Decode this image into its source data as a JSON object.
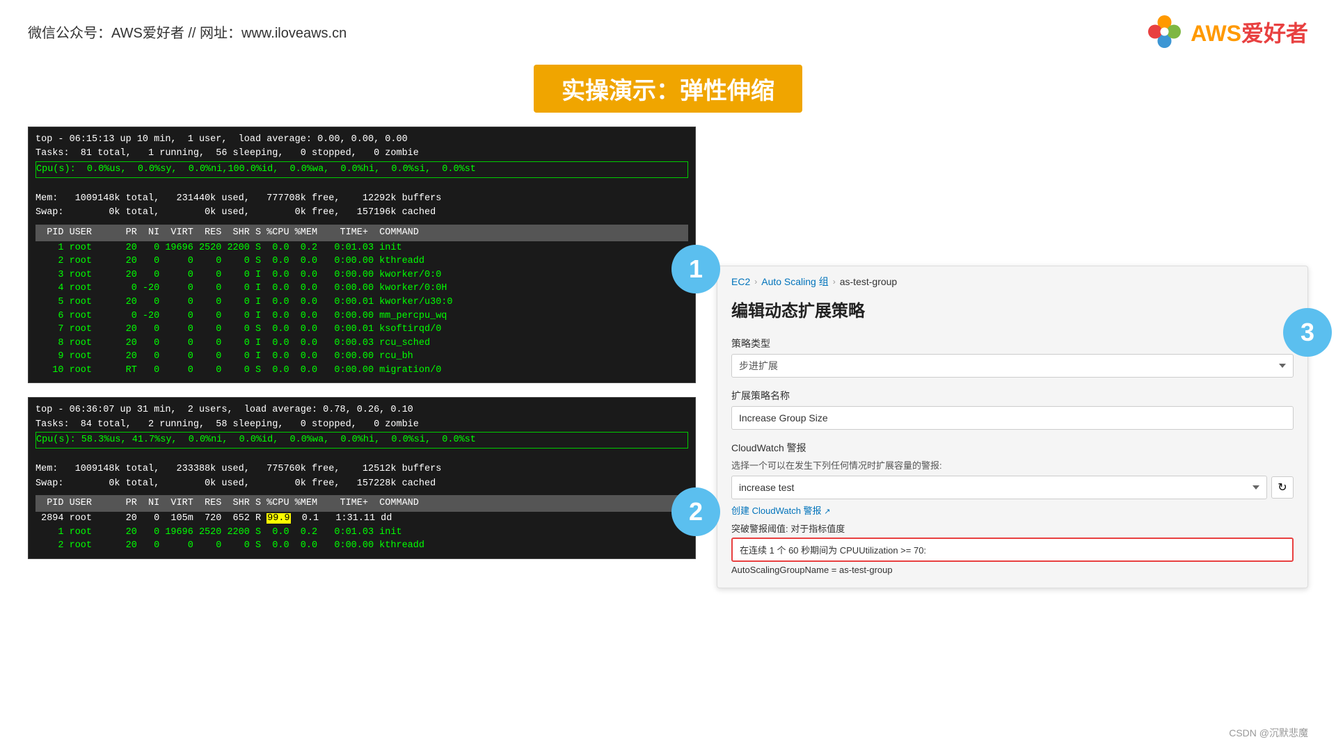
{
  "header": {
    "wechat_text": "微信公众号：AWS爱好者  //  网址：www.iloveaws.cn",
    "logo_text": "AWS爱好者"
  },
  "title": "实操演示：弹性伸缩",
  "terminal1": {
    "line1": "top - 06:15:13 up 10 min,  1 user,  load average: 0.00, 0.00, 0.00",
    "line2": "Tasks:  81 total,   1 running,  56 sleeping,   0 stopped,   0 zombie",
    "line3_highlight": "Cpu(s):  0.0%us,  0.0%sy,  0.0%ni,100.0%id,  0.0%wa,  0.0%hi,  0.0%si,  0.0%st",
    "line4": "Mem:   1009148k total,   231440k used,   777708k free,    12292k buffers",
    "line5": "Swap:        0k total,        0k used,        0k free,   157196k cached",
    "table_header": "  PID USER      PR  NI  VIRT  RES  SHR S %CPU %MEM    TIME+  COMMAND",
    "rows": [
      "    1 root      20   0 19696 2520 2200 S  0.0  0.2   0:01.03 init",
      "    2 root      20   0     0    0    0 S  0.0  0.0   0:00.00 kthreadd",
      "    3 root      20   0     0    0    0 I  0.0  0.0   0:00.00 kworker/0:0",
      "    4 root       0 -20     0    0    0 I  0.0  0.0   0:00.00 kworker/0:0H",
      "    5 root      20   0     0    0    0 I  0.0  0.0   0:00.01 kworker/u30:0",
      "    6 root       0 -20     0    0    0 I  0.0  0.0   0:00.00 mm_percpu_wq",
      "    7 root      20   0     0    0    0 S  0.0  0.0   0:00.01 ksoftirqd/0",
      "    8 root      20   0     0    0    0 I  0.0  0.0   0:00.03 rcu_sched",
      "    9 root      20   0     0    0    0 I  0.0  0.0   0:00.00 rcu_bh",
      "   10 root      RT   0     0    0    0 S  0.0  0.0   0:00.00 migration/0"
    ],
    "badge": "1"
  },
  "terminal2": {
    "line1": "top - 06:36:07 up 31 min,  2 users,  load average: 0.78, 0.26, 0.10",
    "line2": "Tasks:  84 total,   2 running,  58 sleeping,   0 stopped,   0 zombie",
    "line3_highlight": "Cpu(s): 58.3%us, 41.7%sy,  0.0%ni,  0.0%id,  0.0%wa,  0.0%hi,  0.0%si,  0.0%st",
    "line4": "Mem:   1009148k total,   233388k used,   775760k free,    12512k buffers",
    "line5": "Swap:        0k total,        0k used,        0k free,   157228k cached",
    "table_header": "  PID USER      PR  NI  VIRT  RES  SHR S %CPU %MEM    TIME+  COMMAND",
    "rows": [
      " 2894 root      20   0  105m  720  652 R 99.9  0.1   1:31.11 dd",
      "    1 root      20   0 19696 2520 2200 S  0.0  0.2   0:01.03 init",
      "    2 root      20   0     0    0    0 S  0.0  0.0   0:00.00 kthreadd"
    ],
    "badge": "2"
  },
  "console": {
    "breadcrumb": {
      "ec2": "EC2",
      "auto_scaling": "Auto Scaling 组",
      "group_name": "as-test-group"
    },
    "panel_title": "编辑动态扩展策略",
    "strategy_type_label": "策略类型",
    "strategy_type_value": "步进扩展",
    "strategy_name_label": "扩展策略名称",
    "strategy_name_value": "Increase Group Size",
    "cloudwatch_label": "CloudWatch 警报",
    "cloudwatch_sub_label": "选择一个可以在发生下列任何情况时扩展容量的警报:",
    "cloudwatch_value": "increase test",
    "create_alarm_text": "创建 CloudWatch 警报",
    "alarm_condition_label": "突破警报阈值: 对于指标值度",
    "alarm_condition_highlight": "在连续 1 个 60 秒期间为 CPUUtilization >= 70:",
    "alarm_autoscaling": "AutoScalingGroupName = as-test-group",
    "badge": "3"
  },
  "footer": {
    "text": "CSDN @沉默悲魔"
  }
}
